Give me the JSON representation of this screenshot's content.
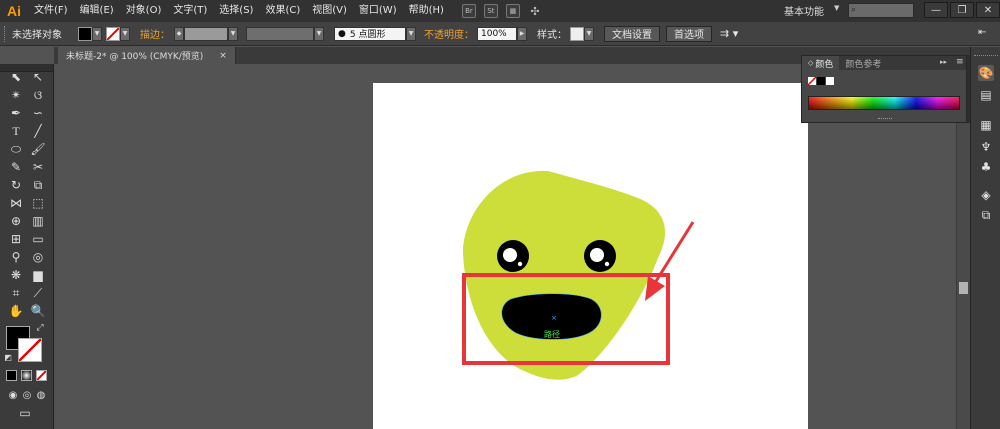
{
  "app": {
    "logo_text": "Ai",
    "menus": [
      "文件(F)",
      "编辑(E)",
      "对象(O)",
      "文字(T)",
      "选择(S)",
      "效果(C)",
      "视图(V)",
      "窗口(W)",
      "帮助(H)"
    ],
    "menu_icons": [
      "Br",
      "St"
    ],
    "workspace_label": "基本功能",
    "window_buttons": [
      "—",
      "❐",
      "✕"
    ]
  },
  "control_bar": {
    "selection_status": "未选择对象",
    "stroke_label": "描边：",
    "brush_label": "5 点圆形",
    "opacity_label": "不透明度：",
    "opacity_value": "100%",
    "style_label": "样式：",
    "doc_setup_button": "文档设置",
    "preferences_button": "首选项"
  },
  "document": {
    "tab_title": "未标题-2* @ 100% (CMYK/预览)",
    "tab_close": "×"
  },
  "canvas": {
    "path_label": "路径",
    "face_color": "#cddd3a",
    "highlight_color": "#e8353a"
  },
  "color_panel": {
    "tabs": [
      "颜色",
      "颜色参考"
    ]
  }
}
